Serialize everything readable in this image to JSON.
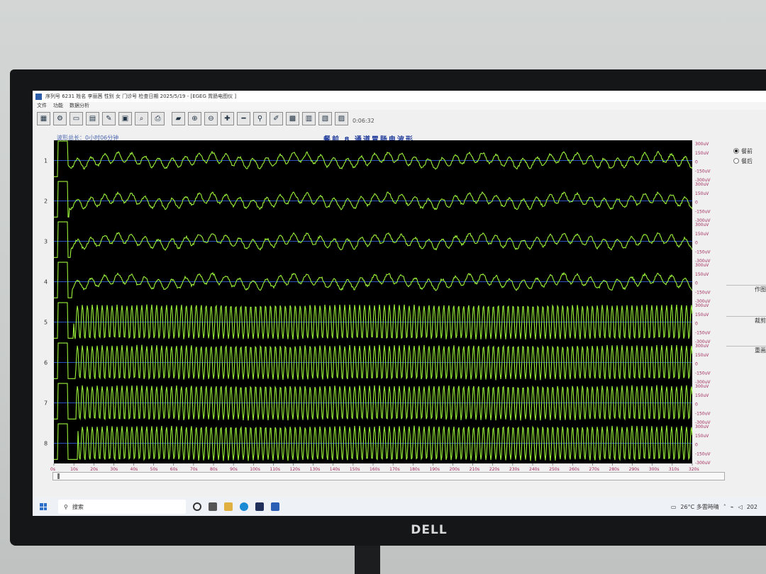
{
  "window": {
    "title": "序列号 6231   姓名 李丽茜   性别 女   门诊号   检查日期 2025/5/19 - [EGEG 胃肠电图仪 ]"
  },
  "menu": [
    "文件",
    "功能",
    "数据分析"
  ],
  "toolbar": {
    "time": "0:06:32"
  },
  "plot": {
    "duration_label": "波形总长：0小时06分钟",
    "title": "餐前 8 通道胃肠电波形"
  },
  "channels": [
    "1",
    "2",
    "3",
    "4",
    "5",
    "6",
    "7",
    "8"
  ],
  "scale_labels": [
    "300uV",
    "150uV",
    "0",
    "-150uV",
    "-300uV"
  ],
  "chart_data": {
    "type": "line",
    "xlabel": "",
    "x_ticks": [
      "0s",
      "10s",
      "20s",
      "30s",
      "40s",
      "50s",
      "60s",
      "70s",
      "80s",
      "90s",
      "100s",
      "110s",
      "120s",
      "130s",
      "140s",
      "150s",
      "160s",
      "170s",
      "180s",
      "190s",
      "200s",
      "210s",
      "220s",
      "230s",
      "240s",
      "250s",
      "260s",
      "270s",
      "280s",
      "290s",
      "300s",
      "310s",
      "320s"
    ],
    "xlim": [
      0,
      320
    ],
    "ylim": [
      -300,
      300
    ],
    "series": [
      {
        "name": "1"
      },
      {
        "name": "2"
      },
      {
        "name": "3"
      },
      {
        "name": "4"
      },
      {
        "name": "5"
      },
      {
        "name": "6"
      },
      {
        "name": "7"
      },
      {
        "name": "8"
      }
    ],
    "colors": {
      "trace": "#9bf23a",
      "baseline": "#3a6cff",
      "background": "#000000",
      "scale": "#a0285a"
    }
  },
  "side_panel": {
    "radio_pre": "餐前",
    "radio_post": "餐后",
    "btn_plot": "作图",
    "btn_trim": "裁剪",
    "btn_redraw": "重画"
  },
  "taskbar": {
    "search": "搜索",
    "weather": "26°C 多雲時晴",
    "date_partial": "202"
  }
}
